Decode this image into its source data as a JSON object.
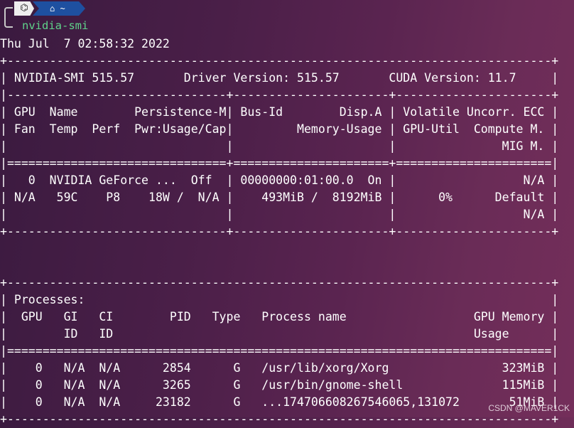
{
  "prompt": {
    "os_icon": "terminal-logo-icon",
    "home_icon": "home-icon",
    "dir": "~",
    "command": "nvidia-smi"
  },
  "output_lines": [
    "Thu Jul  7 02:58:32 2022",
    "+-----------------------------------------------------------------------------+",
    "| NVIDIA-SMI 515.57       Driver Version: 515.57       CUDA Version: 11.7     |",
    "|-------------------------------+----------------------+----------------------+",
    "| GPU  Name        Persistence-M| Bus-Id        Disp.A | Volatile Uncorr. ECC |",
    "| Fan  Temp  Perf  Pwr:Usage/Cap|         Memory-Usage | GPU-Util  Compute M. |",
    "|                               |                      |               MIG M. |",
    "|===============================+======================+======================|",
    "|   0  NVIDIA GeForce ...  Off  | 00000000:01:00.0  On |                  N/A |",
    "| N/A   59C    P8    18W /  N/A |    493MiB /  8192MiB |      0%      Default |",
    "|                               |                      |                  N/A |",
    "+-------------------------------+----------------------+----------------------+",
    "",
    "",
    "+-----------------------------------------------------------------------------+",
    "| Processes:                                                                  |",
    "|  GPU   GI   CI        PID   Type   Process name                  GPU Memory |",
    "|        ID   ID                                                   Usage      |",
    "|=============================================================================|",
    "|    0   N/A  N/A      2854      G   /usr/lib/xorg/Xorg                323MiB |",
    "|    0   N/A  N/A      3265      G   /usr/bin/gnome-shell              115MiB |",
    "|    0   N/A  N/A     23182      G   ...174706608267546065,131072       51MiB |",
    "+-----------------------------------------------------------------------------+"
  ],
  "watermark": "CSDN @MAVER1CK"
}
